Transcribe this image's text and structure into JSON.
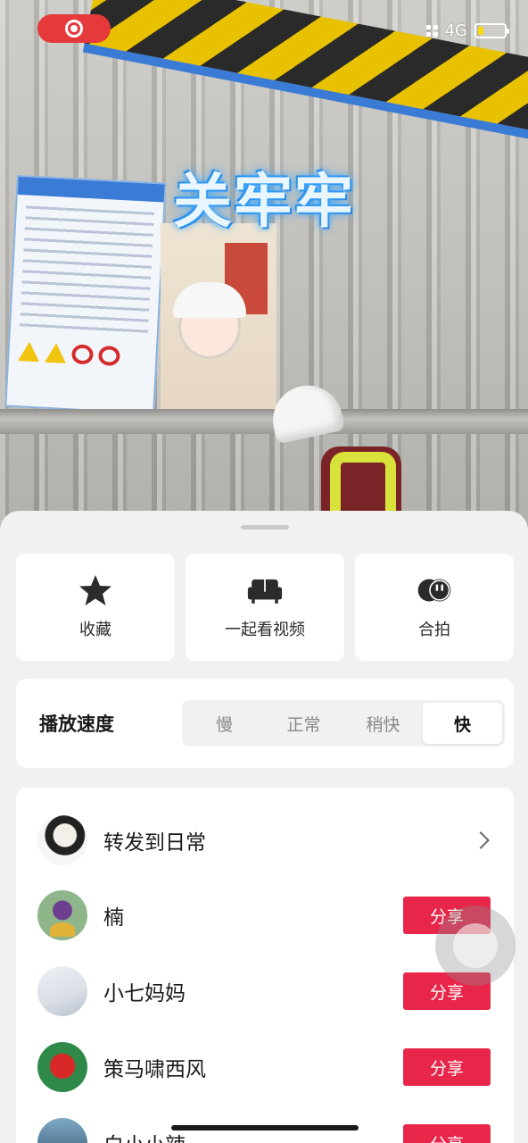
{
  "video": {
    "overlay_title": "关牢牢"
  },
  "status_bar": {
    "network": "4G",
    "recording_icon": "record-icon",
    "battery_level": 0.2,
    "battery_color": "#f4d90b"
  },
  "actions": [
    {
      "label": "收藏",
      "icon": "star-icon"
    },
    {
      "label": "一起看视频",
      "icon": "sofa-icon"
    },
    {
      "label": "合拍",
      "icon": "duet-icon"
    }
  ],
  "playback_speed": {
    "title": "播放速度",
    "options": [
      "慢",
      "正常",
      "稍快",
      "快"
    ],
    "selected": "快"
  },
  "share": {
    "forward_label": "转发到日常",
    "button_label": "分享",
    "contacts": [
      {
        "name": "楠"
      },
      {
        "name": "小七妈妈"
      },
      {
        "name": "策马啸西风"
      },
      {
        "name": "白小小辣"
      }
    ]
  },
  "colors": {
    "share_button": "#e8264a",
    "record_pill": "#e5393c",
    "sheet_bg": "#f1f1f2"
  }
}
